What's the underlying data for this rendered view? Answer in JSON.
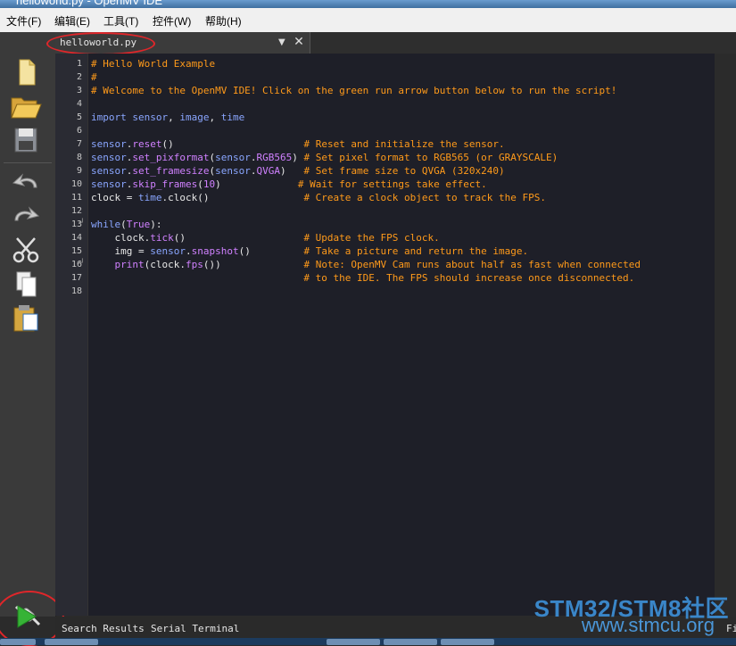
{
  "window": {
    "title": "helloworld.py - OpenMV IDE"
  },
  "menu": [
    "文件(F)",
    "编辑(E)",
    "工具(T)",
    "控件(W)",
    "帮助(H)"
  ],
  "tab": {
    "filename": "helloworld.py"
  },
  "editor": {
    "line_numbers": [
      "1",
      "2",
      "3",
      "4",
      "5",
      "6",
      "7",
      "8",
      "9",
      "10",
      "11",
      "12",
      "13",
      "14",
      "15",
      "16",
      "17",
      "18"
    ]
  },
  "bottom_tabs": [
    "Search Results",
    "Serial Terminal"
  ],
  "bottom_extra": "Fi",
  "watermark": {
    "line1": "STM32/STM8社区",
    "line2": "www.stmcu.org"
  },
  "colors": {
    "comment": "#ff9a1a",
    "keyword": "#8aa6ff",
    "module": "#d081ff",
    "annotation": "#e0262a",
    "run": "#36b336"
  },
  "icons": [
    "new-file-icon",
    "open-folder-icon",
    "save-icon",
    "undo-icon",
    "redo-icon",
    "cut-icon",
    "copy-icon",
    "paste-icon",
    "connect-icon",
    "run-icon"
  ]
}
